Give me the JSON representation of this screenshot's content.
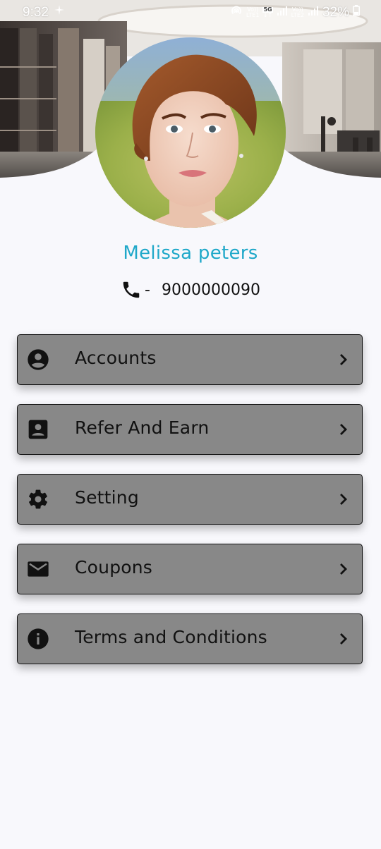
{
  "status_bar": {
    "time": "9:32",
    "net1_top": "Vo))",
    "net1_bottom": "LTE1",
    "net_5g": "5G",
    "net2_top": "Vo))",
    "net2_bottom": "LTE2",
    "battery": "32%"
  },
  "profile": {
    "name": "Melissa peters",
    "phone_separator": "-",
    "phone": "9000000090"
  },
  "menu": [
    {
      "label": "Accounts",
      "icon": "account-circle-icon"
    },
    {
      "label": "Refer And Earn",
      "icon": "contact-card-icon"
    },
    {
      "label": "Setting",
      "icon": "gear-icon"
    },
    {
      "label": "Coupons",
      "icon": "mail-icon"
    },
    {
      "label": "Terms and Conditions",
      "icon": "info-icon"
    }
  ],
  "colors": {
    "name": "#1fa8c9",
    "menu_bg": "#888888",
    "page_bg": "#f8f8fc"
  }
}
